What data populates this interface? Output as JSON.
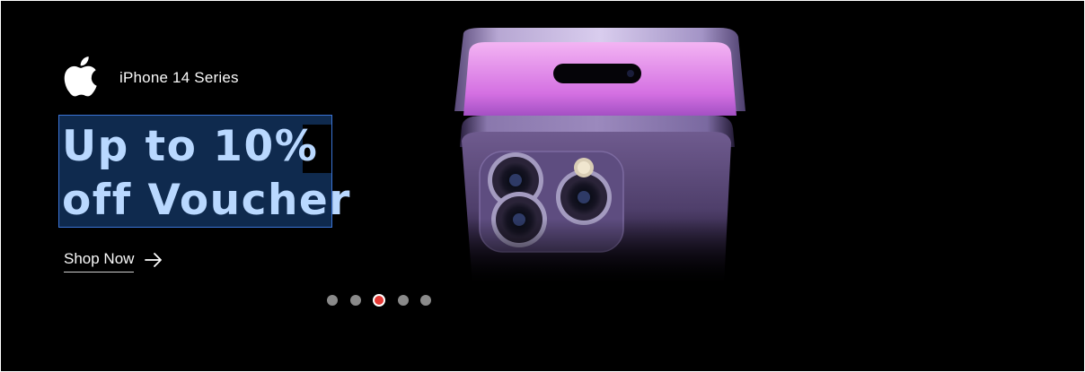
{
  "hero": {
    "brand_logo_icon": "apple-logo-icon",
    "series_label": "iPhone 14 Series",
    "headline_line1": "Up to 10%",
    "headline_line2": "off Voucher",
    "cta_label": "Shop Now",
    "cta_icon": "arrow-right-icon",
    "product_image": "iphone-14-pro-image",
    "carousel": {
      "slide_count": 5,
      "active_index": 2
    },
    "colors": {
      "background": "#000000",
      "active_dot": "#e53935",
      "inactive_dot": "#8a8a8a",
      "text": "#fafafa",
      "selection_fill": "#0f2a4e",
      "selection_border": "#3b74d6",
      "selected_text": "#b9d8ff"
    }
  }
}
